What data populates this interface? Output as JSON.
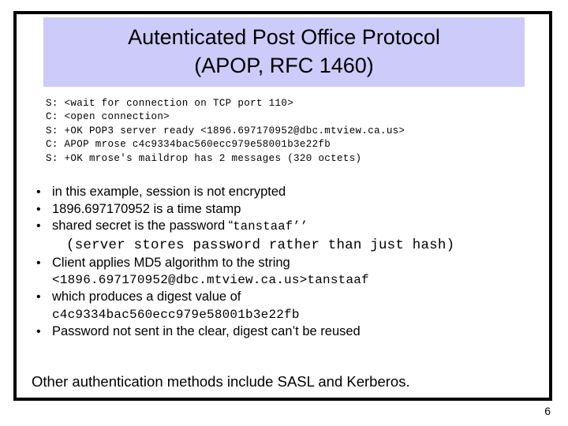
{
  "slide": {
    "title": "Autenticated Post Office Protocol\n(APOP, RFC 1460)",
    "title_background": "#cccbf9",
    "frame_color": "#000000",
    "page_number": "6"
  },
  "transcript": {
    "lines": [
      "S: <wait for connection on TCP port 110>",
      "C: <open connection>",
      "S: +OK POP3 server ready <1896.697170952@dbc.mtview.ca.us>",
      "C: APOP mrose c4c9334bac560ecc979e58001b3e22fb",
      "S: +OK mrose's maildrop has 2 messages (320 octets)"
    ]
  },
  "bullets": {
    "marker": "•",
    "items": [
      {
        "main_text": "in this example, session is not encrypted",
        "main_mono_suffix": "",
        "sub_lines": []
      },
      {
        "main_text": "1896.697170952 is a time stamp",
        "main_mono_suffix": "",
        "sub_lines": []
      },
      {
        "main_text": "shared secret is the password “",
        "main_mono_suffix": "tanstaaf’’",
        "sub_lines": [
          {
            "style": "mono-big",
            "indent": "paren",
            "text": "(server stores password rather than just hash)"
          }
        ]
      },
      {
        "main_text": "Client applies MD5 algorithm to the string",
        "main_mono_suffix": "",
        "sub_lines": [
          {
            "style": "mono",
            "indent": "cont",
            "text": "<1896.697170952@dbc.mtview.ca.us>tanstaaf"
          }
        ]
      },
      {
        "main_text": "which produces a digest value of",
        "main_mono_suffix": "",
        "sub_lines": [
          {
            "style": "mono",
            "indent": "cont",
            "text": "c4c9334bac560ecc979e58001b3e22fb"
          }
        ]
      },
      {
        "main_text": "Password not sent in the clear, digest can’t be reused",
        "main_mono_suffix": "",
        "sub_lines": []
      }
    ]
  },
  "closing": {
    "text": "Other authentication methods include SASL and Kerberos."
  }
}
